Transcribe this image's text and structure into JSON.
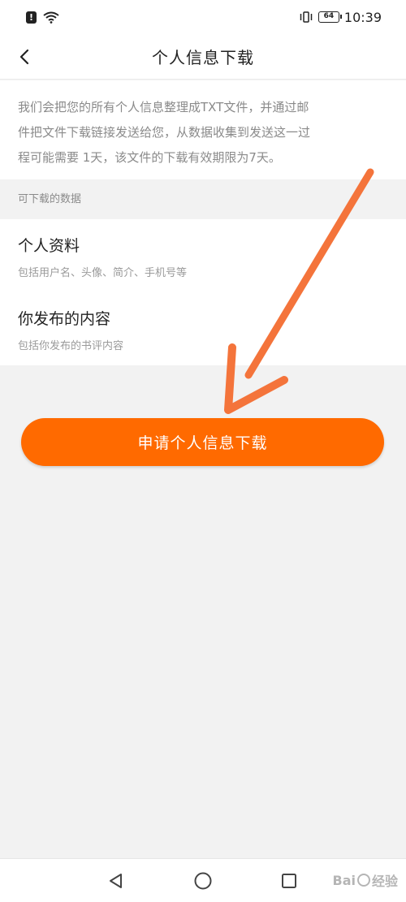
{
  "status_bar": {
    "alert": "!",
    "battery_level": "64",
    "time": "10:39"
  },
  "header": {
    "title": "个人信息下载"
  },
  "description": {
    "line1": "我们会把您的所有个人信息整理成TXT文件，并通过邮",
    "line2": "件把文件下载链接发送给您，从数据收集到发送这一过",
    "line3": "程可能需要 1天，该文件的下载有效期限为7天。"
  },
  "section": {
    "label": "可下载的数据"
  },
  "data_items": [
    {
      "title": "个人资料",
      "subtitle": "包括用户名、头像、简介、手机号等"
    },
    {
      "title": "你发布的内容",
      "subtitle": "包括你发布的书评内容"
    }
  ],
  "request_button": {
    "label": "申请个人信息下载"
  },
  "watermark": {
    "text_left": "Bai",
    "text_right": "经验"
  },
  "colors": {
    "accent": "#ff6a00",
    "annotation_arrow": "#f4743b"
  },
  "icons": {
    "back": "chevron-left-icon",
    "nav_back": "triangle-back-icon",
    "nav_home": "circle-home-icon",
    "nav_recent": "square-recent-icon"
  }
}
